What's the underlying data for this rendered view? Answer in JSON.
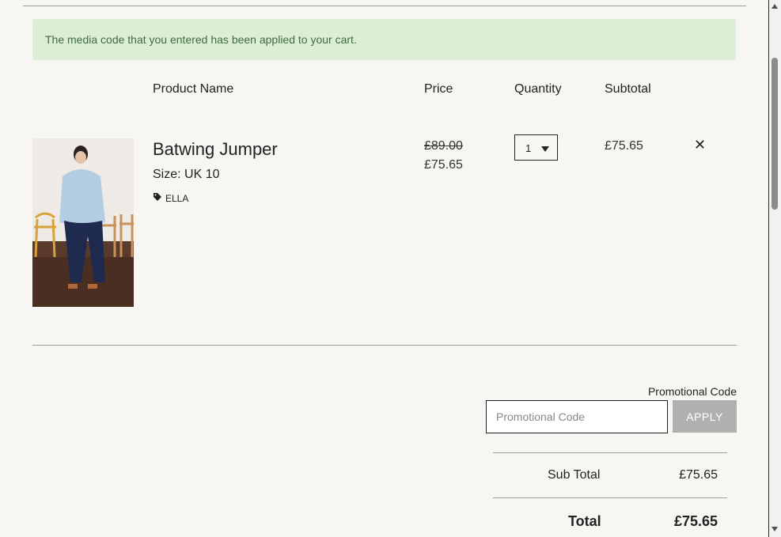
{
  "notice": {
    "text": "The media code that you entered has been applied to your cart."
  },
  "table_headers": {
    "product": "Product Name",
    "price": "Price",
    "quantity": "Quantity",
    "subtotal": "Subtotal"
  },
  "cart_item": {
    "name": "Batwing Jumper",
    "size": "Size: UK 10",
    "tag": "ELLA",
    "price_original": "£89.00",
    "price_current": "£75.65",
    "quantity": "1",
    "subtotal": "£75.65",
    "remove_symbol": "✕"
  },
  "promo": {
    "label": "Promotional Code",
    "placeholder": "Promotional Code",
    "apply_label": "APPLY"
  },
  "summary": {
    "sub_total_label": "Sub Total",
    "sub_total_value": "£75.65",
    "total_label": "Total",
    "total_value": "£75.65"
  },
  "icons": {
    "tag": "tag-icon",
    "remove": "close-icon",
    "select": "chevron-down-icon"
  },
  "colors": {
    "notice_bg": "#dcefd6",
    "notice_text": "#3f6b3f",
    "page_bg": "#f8f6f2",
    "button_disabled": "#b0b0b0"
  }
}
